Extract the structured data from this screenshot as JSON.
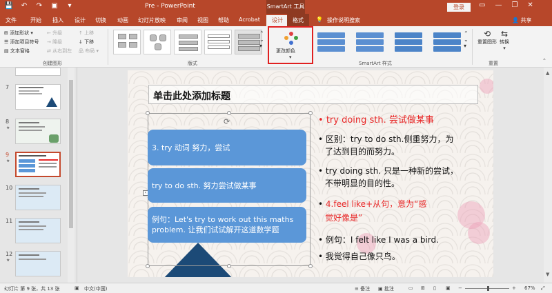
{
  "titlebar": {
    "qat": [
      "💾",
      "↶",
      "↷",
      "▣",
      "▾"
    ],
    "title": "Pre  -  PowerPoint",
    "context_label": "SmartArt 工具",
    "login_label": "登录",
    "window_controls": [
      "▭",
      "—",
      "❐",
      "✕"
    ]
  },
  "tabs": {
    "items": [
      "文件",
      "开始",
      "插入",
      "设计",
      "切换",
      "动画",
      "幻灯片放映",
      "审阅",
      "视图",
      "帮助",
      "Acrobat"
    ],
    "context_tabs": [
      "设计",
      "格式"
    ],
    "tell_me": "操作说明搜索",
    "share": "共享"
  },
  "ribbon": {
    "create_graphic": {
      "add_shape": "添加形状",
      "add_bullet": "添加项目符号",
      "text_pane": "文本窗格",
      "promote": "升级",
      "demote": "降级",
      "right_to_left": "从右到左",
      "move_up": "上移",
      "move_down": "下移",
      "layout": "布局",
      "label": "创建图形"
    },
    "layouts_label": "版式",
    "change_colors": "更改颜色",
    "smartart_styles_label": "SmartArt 样式",
    "reset_graphic": "重置图形",
    "convert": "转换",
    "reset_label": "重置"
  },
  "thumbnails": [
    {
      "num": "7",
      "star": ""
    },
    {
      "num": "8",
      "star": "★"
    },
    {
      "num": "9",
      "star": "★"
    },
    {
      "num": "10",
      "star": ""
    },
    {
      "num": "11",
      "star": ""
    },
    {
      "num": "12",
      "star": "★"
    }
  ],
  "slide": {
    "title_placeholder": "单击此处添加标题",
    "smartart_items": [
      "3. try 动词  努力，尝试",
      "try to do sth. 努力尝试做某事",
      "例句：Let's try to work out this maths problem. 让我们试试解开这道数学题"
    ],
    "bullets": [
      {
        "text": "try doing sth. 尝试做某事",
        "red": true
      },
      {
        "text": "区别：try to do sth.侧重努力，为",
        "red": false
      },
      {
        "text": "了达到目的而努力。",
        "red": false,
        "cont": true
      },
      {
        "text": "try doing sth. 只是一种新的尝试，",
        "red": false
      },
      {
        "text": "不带明显的目的性。",
        "red": false,
        "cont": true
      },
      {
        "text": "4.feel like+从句，意为“感",
        "red": true,
        "prefix": "4."
      },
      {
        "text": "觉好像是”",
        "red": true,
        "cont": true
      },
      {
        "text": "例句：I felt like I was a bird.",
        "red": false
      },
      {
        "text": "我觉得自己像只鸟。",
        "red": false
      }
    ]
  },
  "statusbar": {
    "slide_info": "幻灯片 第 9 张，共 13 张",
    "language": "中文(中国)",
    "notes": "备注",
    "comments": "批注",
    "zoom": "67%"
  },
  "colors": {
    "ppt_red": "#b7472a",
    "smartart_blue": "#5b97d8",
    "highlight_red": "#e82727"
  }
}
